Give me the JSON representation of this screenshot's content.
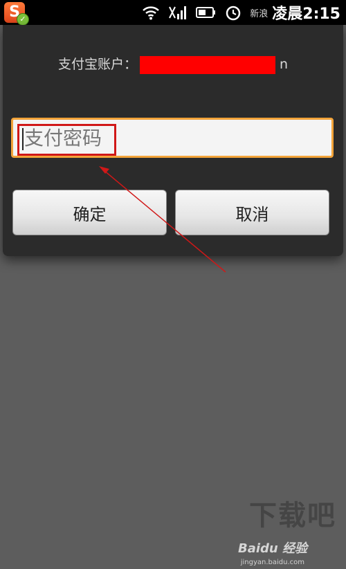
{
  "status_bar": {
    "app_icon_letter": "S",
    "app_icon_badge": "✓",
    "overlay_text": "新浪",
    "clock": "凌晨2:15"
  },
  "dialog": {
    "account_label": "支付宝账户：",
    "account_tail": "n",
    "password": {
      "placeholder": "支付密码",
      "value": ""
    },
    "confirm_label": "确定",
    "cancel_label": "取消"
  },
  "watermarks": {
    "site_mark": "下载吧",
    "baidu_brand": "Baidu 经验",
    "baidu_url": "jingyan.baidu.com"
  },
  "colors": {
    "input_focus_border": "#f3a43a",
    "annotation_red": "#d01818",
    "redaction": "#ff0000"
  }
}
